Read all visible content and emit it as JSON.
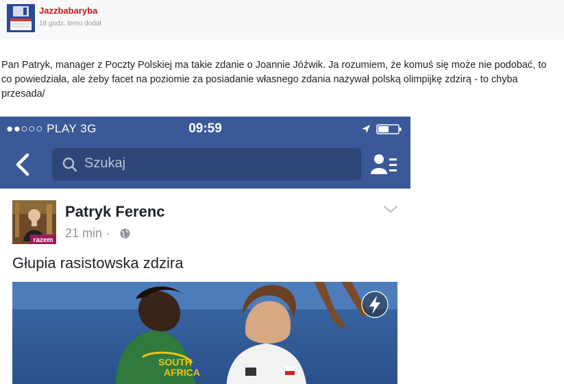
{
  "author": {
    "name": "Jazzbabaryba",
    "meta": "18 godz. temu dodał"
  },
  "post": {
    "text": "Pan Patryk, manager z Poczty Polskiej ma takie zdanie o Joannie Jóźwik. Ja rozumiem, że komuś się może nie podobać, to co powiedziała, ale żeby facet na poziomie za posiadanie własnego zdania nazywał polską olimpijkę zdzirą - to chyba przesada/"
  },
  "screenshot": {
    "status": {
      "carrier": "●●○○○ PLAY   3G",
      "time": "09:59"
    },
    "search": {
      "placeholder": "Szukaj"
    },
    "fb_post": {
      "author": "Patryk Ferenc",
      "time": "21 min ·",
      "avatar_badge": "razem",
      "text": "Głupia rasistowska zdzira",
      "photo_text": [
        "SOUTH",
        "AFRICA"
      ]
    }
  },
  "colors": {
    "fb_blue": "#3b5998",
    "author_red": "#c01818"
  },
  "icons": [
    "floppy-disk-avatar",
    "back-chevron-icon",
    "search-icon",
    "friends-list-icon",
    "location-arrow-icon",
    "battery-icon",
    "globe-icon",
    "chevron-down-icon",
    "lightning-icon"
  ]
}
